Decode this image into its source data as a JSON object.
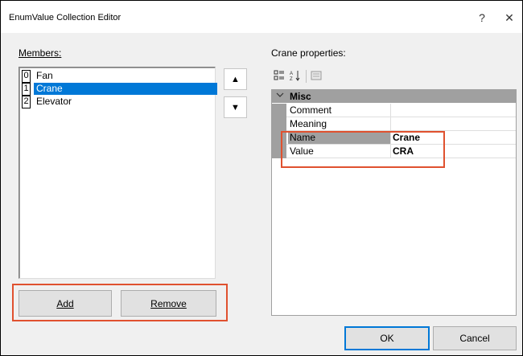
{
  "window": {
    "title": "EnumValue Collection Editor",
    "help_label": "?",
    "close_label": "✕"
  },
  "members": {
    "label": "Members:",
    "items": [
      {
        "index": "0",
        "name": "Fan"
      },
      {
        "index": "1",
        "name": "Crane",
        "selected": true
      },
      {
        "index": "2",
        "name": "Elevator"
      }
    ],
    "move_up_label": "▲",
    "move_down_label": "▼",
    "add_label": "Add",
    "remove_label": "Remove"
  },
  "properties": {
    "label": "Crane properties:",
    "toolbar": [
      "categorized-icon",
      "alphabetical-icon",
      "property-pages-icon"
    ],
    "category": "Misc",
    "rows": [
      {
        "name": "Comment",
        "value": ""
      },
      {
        "name": "Meaning",
        "value": ""
      },
      {
        "name": "Name",
        "value": "Crane",
        "selected": true
      },
      {
        "name": "Value",
        "value": "CRA"
      }
    ]
  },
  "footer": {
    "ok_label": "OK",
    "cancel_label": "Cancel"
  },
  "colors": {
    "selection": "#0078d7",
    "highlight_box": "#e0512f",
    "grid_gray": "#a0a0a0"
  }
}
